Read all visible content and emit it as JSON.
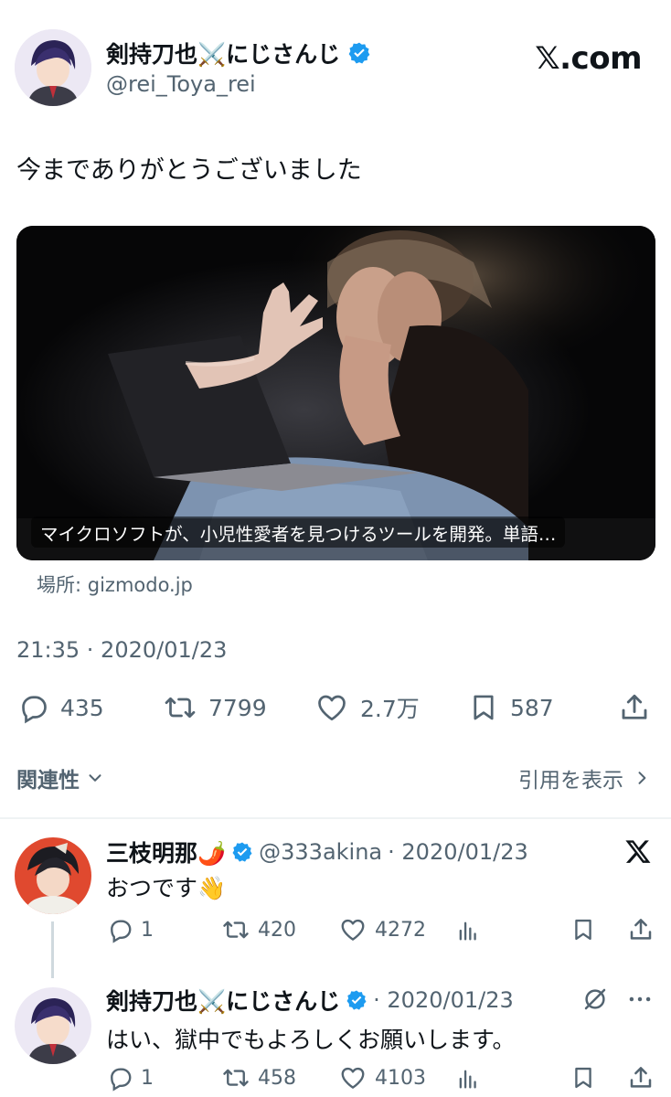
{
  "main_tweet": {
    "author_name": "剣持刀也⚔️にじさんじ",
    "handle": "@rei_Toya_rei",
    "brand": "𝕏.com",
    "text": "今までありがとうございました",
    "card": {
      "title": "マイクロソフトが、小児性愛者を見つけるツールを開発。単語…",
      "source": "場所: gizmodo.jp"
    },
    "timestamp": "21:35 · 2020/01/23",
    "stats": {
      "replies": "435",
      "retweets": "7799",
      "likes": "2.7万",
      "bookmarks": "587"
    }
  },
  "related": {
    "label": "関連性",
    "quotes_label": "引用を表示"
  },
  "replies": [
    {
      "author_name": "三枝明那🌶️",
      "handle": "@333akina",
      "date": "· 2020/01/23",
      "text": "おつです👋",
      "stats": {
        "replies": "1",
        "retweets": "420",
        "likes": "4272"
      }
    },
    {
      "author_name": "剣持刀也⚔️にじさんじ",
      "date": "· 2020/01/23",
      "text": "はい、獄中でもよろしくお願いします。",
      "stats": {
        "replies": "1",
        "retweets": "458",
        "likes": "4103"
      }
    }
  ],
  "colors": {
    "verified": "#1d9bf0",
    "text": "#0f1419",
    "muted": "#536471",
    "divider": "#eff3f4"
  }
}
